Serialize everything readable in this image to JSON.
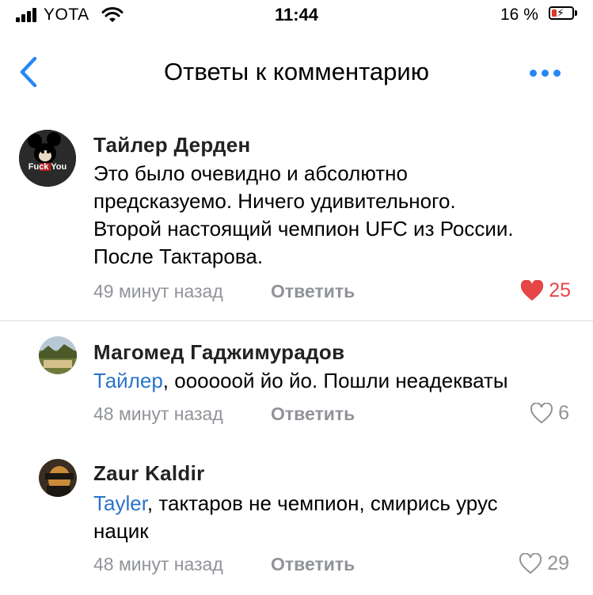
{
  "status_bar": {
    "carrier": "YOTA",
    "time": "11:44",
    "battery_percent": "16 %",
    "battery_level": 0.16,
    "signal_icon": "signal-bars-icon",
    "wifi_icon": "wifi-icon",
    "battery_icon": "battery-charging-icon"
  },
  "nav": {
    "title": "Ответы к комментарию",
    "back_icon": "chevron-left-icon",
    "more_icon": "more-dots-icon",
    "accent": "#2787f5"
  },
  "comments": [
    {
      "author": "Тайлер Дерден",
      "avatar_text": "Fuck You",
      "lines": [
        "Это было очевидно и абсолютно",
        "предсказуемо. Ничего удивительного.",
        "Второй настоящий чемпион UFC из России.",
        "После Тактарова."
      ],
      "time": "49 минут назад",
      "reply_label": "Ответить",
      "likes": "25",
      "liked": true
    },
    {
      "author": "Магомед Гаджимурадов",
      "mention": "Тайлер",
      "lines": [
        ", оооооой йо йо. Пошли неадекваты"
      ],
      "time": "48 минут назад",
      "reply_label": "Ответить",
      "likes": "6",
      "liked": false
    },
    {
      "author": "Zaur Kaldir",
      "mention": "Tayler",
      "lines": [
        ", тактаров не чемпион, смирись урус",
        "нацик"
      ],
      "time": "48 минут назад",
      "reply_label": "Ответить",
      "likes": "29",
      "liked": false
    }
  ],
  "colors": {
    "like_active": "#e64646",
    "meta": "#909399",
    "mention": "#2a75c8"
  }
}
